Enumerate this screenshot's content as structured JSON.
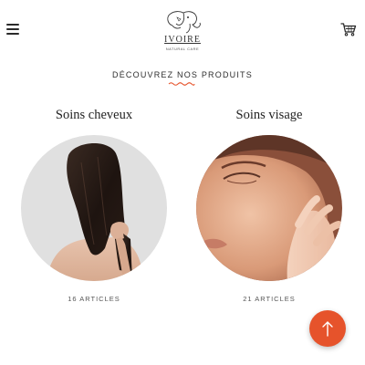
{
  "header": {
    "logo": {
      "name": "IVOIRE",
      "tagline": "NATURAL CARE"
    },
    "menu_icon": "hamburger-menu-icon",
    "cart_icon": "shopping-cart-icon"
  },
  "section": {
    "title": "DÉCOUVREZ NOS PRODUITS"
  },
  "categories": [
    {
      "title": "Soins cheveux",
      "count": "16 ARTICLES",
      "image": "woman-long-dark-hair-back-view"
    },
    {
      "title": "Soins visage",
      "count": "21 ARTICLES",
      "image": "woman-face-closed-eyes-skincare"
    }
  ],
  "scroll_top": {
    "icon": "arrow-up-icon"
  },
  "colors": {
    "accent": "#e6532b",
    "text": "#222222",
    "circle_bg": "#e0e0e0"
  }
}
